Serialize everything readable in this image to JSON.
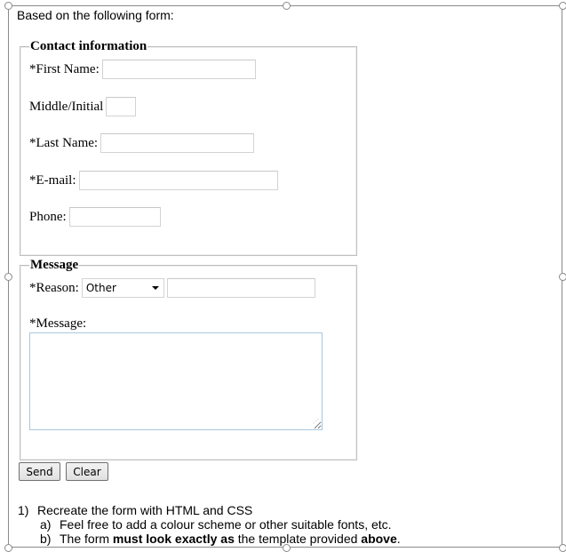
{
  "intro_text": "Based on the following form:",
  "contact": {
    "legend": "Contact information",
    "first_name_label": "*First Name:",
    "middle_initial_label": "Middle/Initial",
    "last_name_label": "*Last Name:",
    "email_label": "*E-mail:",
    "phone_label": "Phone:",
    "first_name_value": "",
    "middle_initial_value": "",
    "last_name_value": "",
    "email_value": "",
    "phone_value": ""
  },
  "message": {
    "legend": "Message",
    "reason_label": "*Reason:",
    "reason_selected": "Other",
    "reason_other_value": "",
    "message_label": "*Message:",
    "message_value": ""
  },
  "buttons": {
    "send": "Send",
    "clear": "Clear"
  },
  "instructions": {
    "item1_num": "1)",
    "item1_text": "Recreate the form with HTML and CSS",
    "item1a_num": "a)",
    "item1a_text": "Feel free to add a colour scheme or other suitable fonts, etc.",
    "item1b_num": "b)",
    "item1b_pre": "The form ",
    "item1b_bold1": "must look exactly as",
    "item1b_mid": " the template provided ",
    "item1b_bold2": "above",
    "item1b_end": "."
  }
}
